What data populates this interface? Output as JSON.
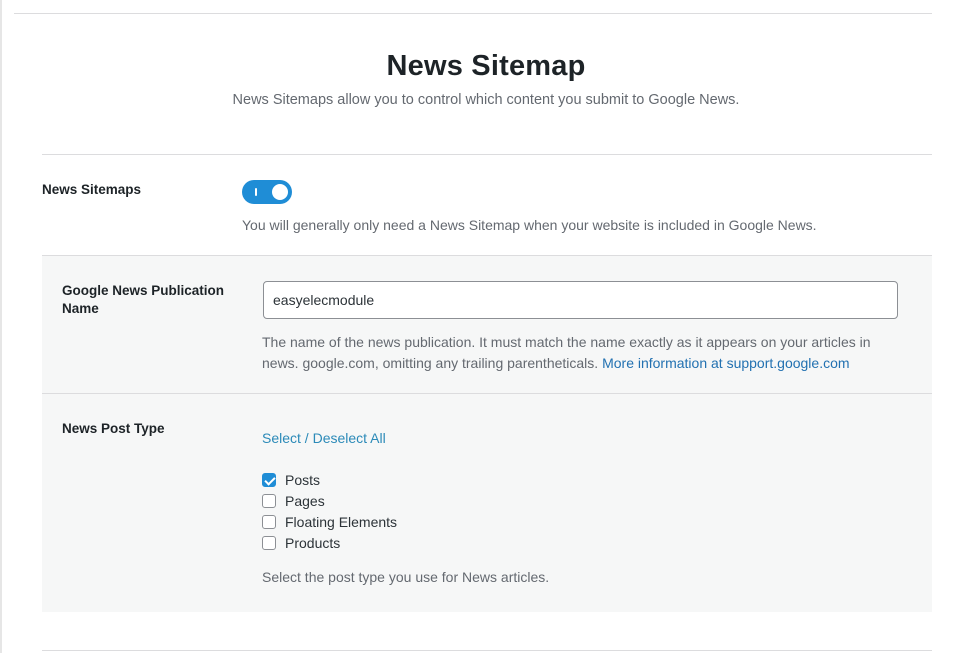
{
  "header": {
    "title": "News Sitemap",
    "subtitle": "News Sitemaps allow you to control which content you submit to Google News."
  },
  "news_sitemaps": {
    "label": "News Sitemaps",
    "toggle_enabled": true,
    "description": "You will generally only need a News Sitemap when your website is included in Google News."
  },
  "publication": {
    "label": "Google News Publication Name",
    "value": "easyelecmodule",
    "description": "The name of the news publication. It must match the name exactly as it appears on your articles in news. google.com, omitting any trailing parentheticals.",
    "more_info_link": "More information at support.google.com"
  },
  "post_type": {
    "label": "News Post Type",
    "select_all_link": "Select / Deselect All",
    "options": [
      {
        "label": "Posts",
        "checked": true
      },
      {
        "label": "Pages",
        "checked": false
      },
      {
        "label": "Floating Elements",
        "checked": false
      },
      {
        "label": "Products",
        "checked": false
      }
    ],
    "description": "Select the post type you use for News articles."
  },
  "colors": {
    "accent": "#1f8dd6",
    "link": "#2271b1",
    "panel_bg": "#f6f7f7"
  }
}
